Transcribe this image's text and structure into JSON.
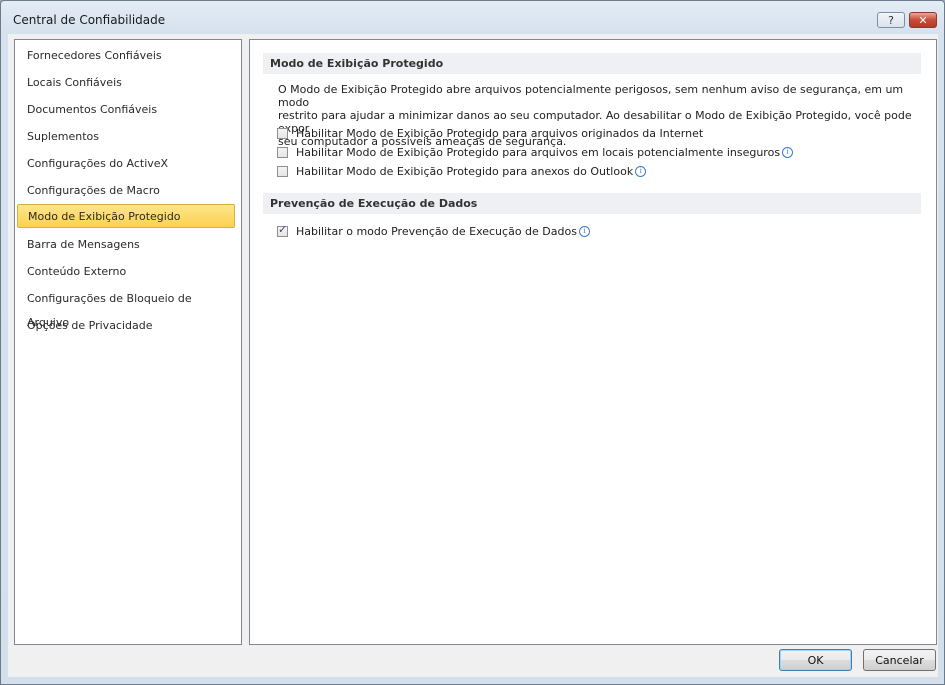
{
  "window": {
    "title": "Central de Confiabilidade",
    "help_label": "?",
    "close_label": "✕"
  },
  "sidebar": {
    "items": [
      {
        "label": "Fornecedores Confiáveis"
      },
      {
        "label": "Locais Confiáveis"
      },
      {
        "label": "Documentos Confiáveis"
      },
      {
        "label": "Suplementos"
      },
      {
        "label": "Configurações do ActiveX"
      },
      {
        "label": "Configurações de Macro"
      },
      {
        "label": "Modo de Exibição Protegido",
        "selected": true
      },
      {
        "label": "Barra de Mensagens"
      },
      {
        "label": "Conteúdo Externo"
      },
      {
        "label": "Configurações de Bloqueio de Arquivo"
      },
      {
        "label": "Opções de Privacidade"
      }
    ]
  },
  "protected_view": {
    "header": "Modo de Exibição Protegido",
    "description_lines": [
      "O Modo de Exibição Protegido abre arquivos potencialmente perigosos, sem nenhum aviso de segurança, em um modo",
      "restrito para ajudar a minimizar danos ao seu computador. Ao desabilitar o Modo de Exibição Protegido, você pode expor",
      "seu computador a possíveis ameaças de segurança."
    ],
    "options": [
      {
        "label": "Habilitar Modo de Exibição Protegido para arquivos originados da Internet",
        "checked": false,
        "info": false
      },
      {
        "label": "Habilitar Modo de Exibição Protegido para arquivos em locais potencialmente inseguros",
        "checked": false,
        "info": true
      },
      {
        "label": "Habilitar Modo de Exibição Protegido para anexos do Outlook",
        "checked": false,
        "info": true
      }
    ]
  },
  "dep": {
    "header": "Prevenção de Execução de Dados",
    "option": {
      "label": "Habilitar o modo Prevenção de Execução de Dados",
      "checked": true,
      "info": true
    }
  },
  "buttons": {
    "ok_label": "OK",
    "cancel_label": "Cancelar"
  },
  "icons": {
    "info": "info-icon",
    "check": "checkmark-icon"
  },
  "colors": {
    "selected_item_bg": "#fbd24f",
    "info_icon": "#3a7bd5",
    "close_button": "#c94a35"
  }
}
